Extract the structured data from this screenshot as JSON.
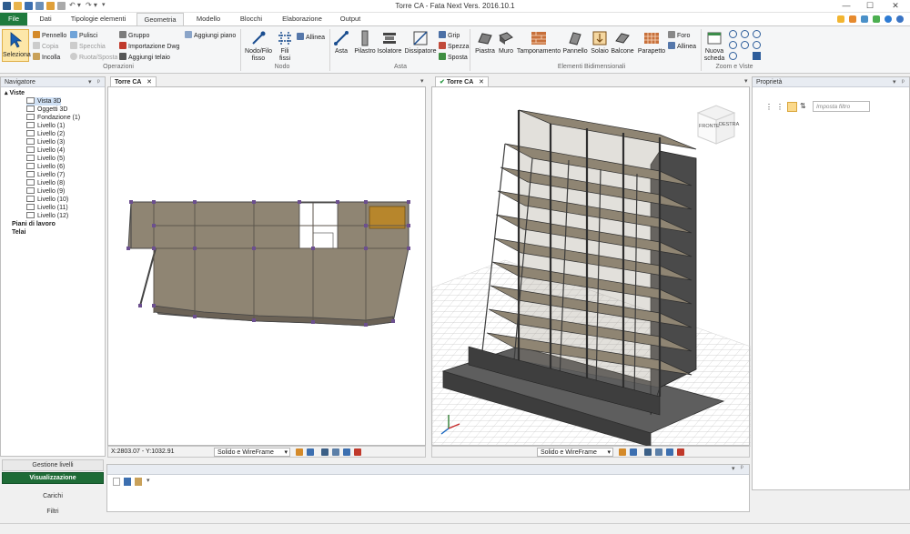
{
  "window": {
    "title": "Torre CA - Fata Next Vers. 2016.10.1",
    "controls": [
      "minimize-icon",
      "maximize-icon",
      "close-icon"
    ]
  },
  "tabs": [
    {
      "label": "File"
    },
    {
      "label": "Dati"
    },
    {
      "label": "Tipologie elementi"
    },
    {
      "label": "Geometria"
    },
    {
      "label": "Modello"
    },
    {
      "label": "Blocchi"
    },
    {
      "label": "Elaborazione"
    },
    {
      "label": "Output"
    }
  ],
  "active_tab": "Geometria",
  "ribbon": {
    "operazioni": {
      "label": "Operazioni",
      "seleziona": "Seleziona",
      "pennello": "Pennello",
      "copia": "Copia",
      "incolla": "Incolla",
      "pulisci": "Pulisci",
      "specchia": "Specchia",
      "ruota_sposta": "Ruota/Sposta",
      "gruppo": "Gruppo",
      "importazione_dwg": "Importazione Dwg",
      "aggiungi_telaio": "Aggiungi telaio",
      "aggiungi_piano": "Aggiungi piano"
    },
    "nodo": {
      "label": "Nodo",
      "nodo_filo_fisso": "Nodo/Filo",
      "nodo_filo_fisso_2": "fisso",
      "fili": "Fili",
      "fili_2": "fissi",
      "allinea": "Allinea"
    },
    "asta": {
      "label": "Asta",
      "asta": "Asta",
      "pilastro": "Pilastro",
      "isolatore": "Isolatore",
      "dissipatore": "Dissipatore",
      "grip": "Grip",
      "spezza": "Spezza",
      "sposta": "Sposta"
    },
    "elementi_bidimensionali": {
      "label": "Elementi Bidimensionali",
      "piastra": "Piastra",
      "muro": "Muro",
      "tamponamento": "Tamponamento",
      "pannello": "Pannello",
      "solaio": "Solaio",
      "balcone": "Balcone",
      "parapetto": "Parapetto",
      "foro": "Foro",
      "allinea": "Allinea"
    },
    "zoom_viste": {
      "label": "Zoom e Viste",
      "nuova_scheda": "Nuova",
      "nuova_scheda_2": "scheda"
    }
  },
  "navigator": {
    "title": "Navigatore",
    "root": "Viste",
    "items": [
      "Vista 3D",
      "Oggetti 3D",
      "Fondazione (1)",
      "Livello (1)",
      "Livello (2)",
      "Livello (3)",
      "Livello (4)",
      "Livello (5)",
      "Livello (6)",
      "Livello (7)",
      "Livello (8)",
      "Livello (9)",
      "Livello (10)",
      "Livello (11)",
      "Livello (12)"
    ],
    "piani": "Piani di lavoro",
    "telai": "Telai",
    "buttons": [
      "Gestione livelli",
      "Visualizzazione",
      "Carichi",
      "Filtri"
    ]
  },
  "views": {
    "left": {
      "tab": "Torre CA",
      "coords": "X:2803.07 - Y:1032.91",
      "mode": "Solido e WireFrame"
    },
    "right": {
      "tab": "Torre CA",
      "mode": "Solido e WireFrame",
      "cube_front": "FRONTE",
      "cube_right": "DESTRA"
    }
  },
  "properties": {
    "title": "Proprietà",
    "filter_placeholder": "Imposta filtro"
  },
  "colors": {
    "accent_green": "#1f7a3d",
    "slab": "#8f8573",
    "wall": "#5b5b5b",
    "selected": "#b7862c"
  }
}
